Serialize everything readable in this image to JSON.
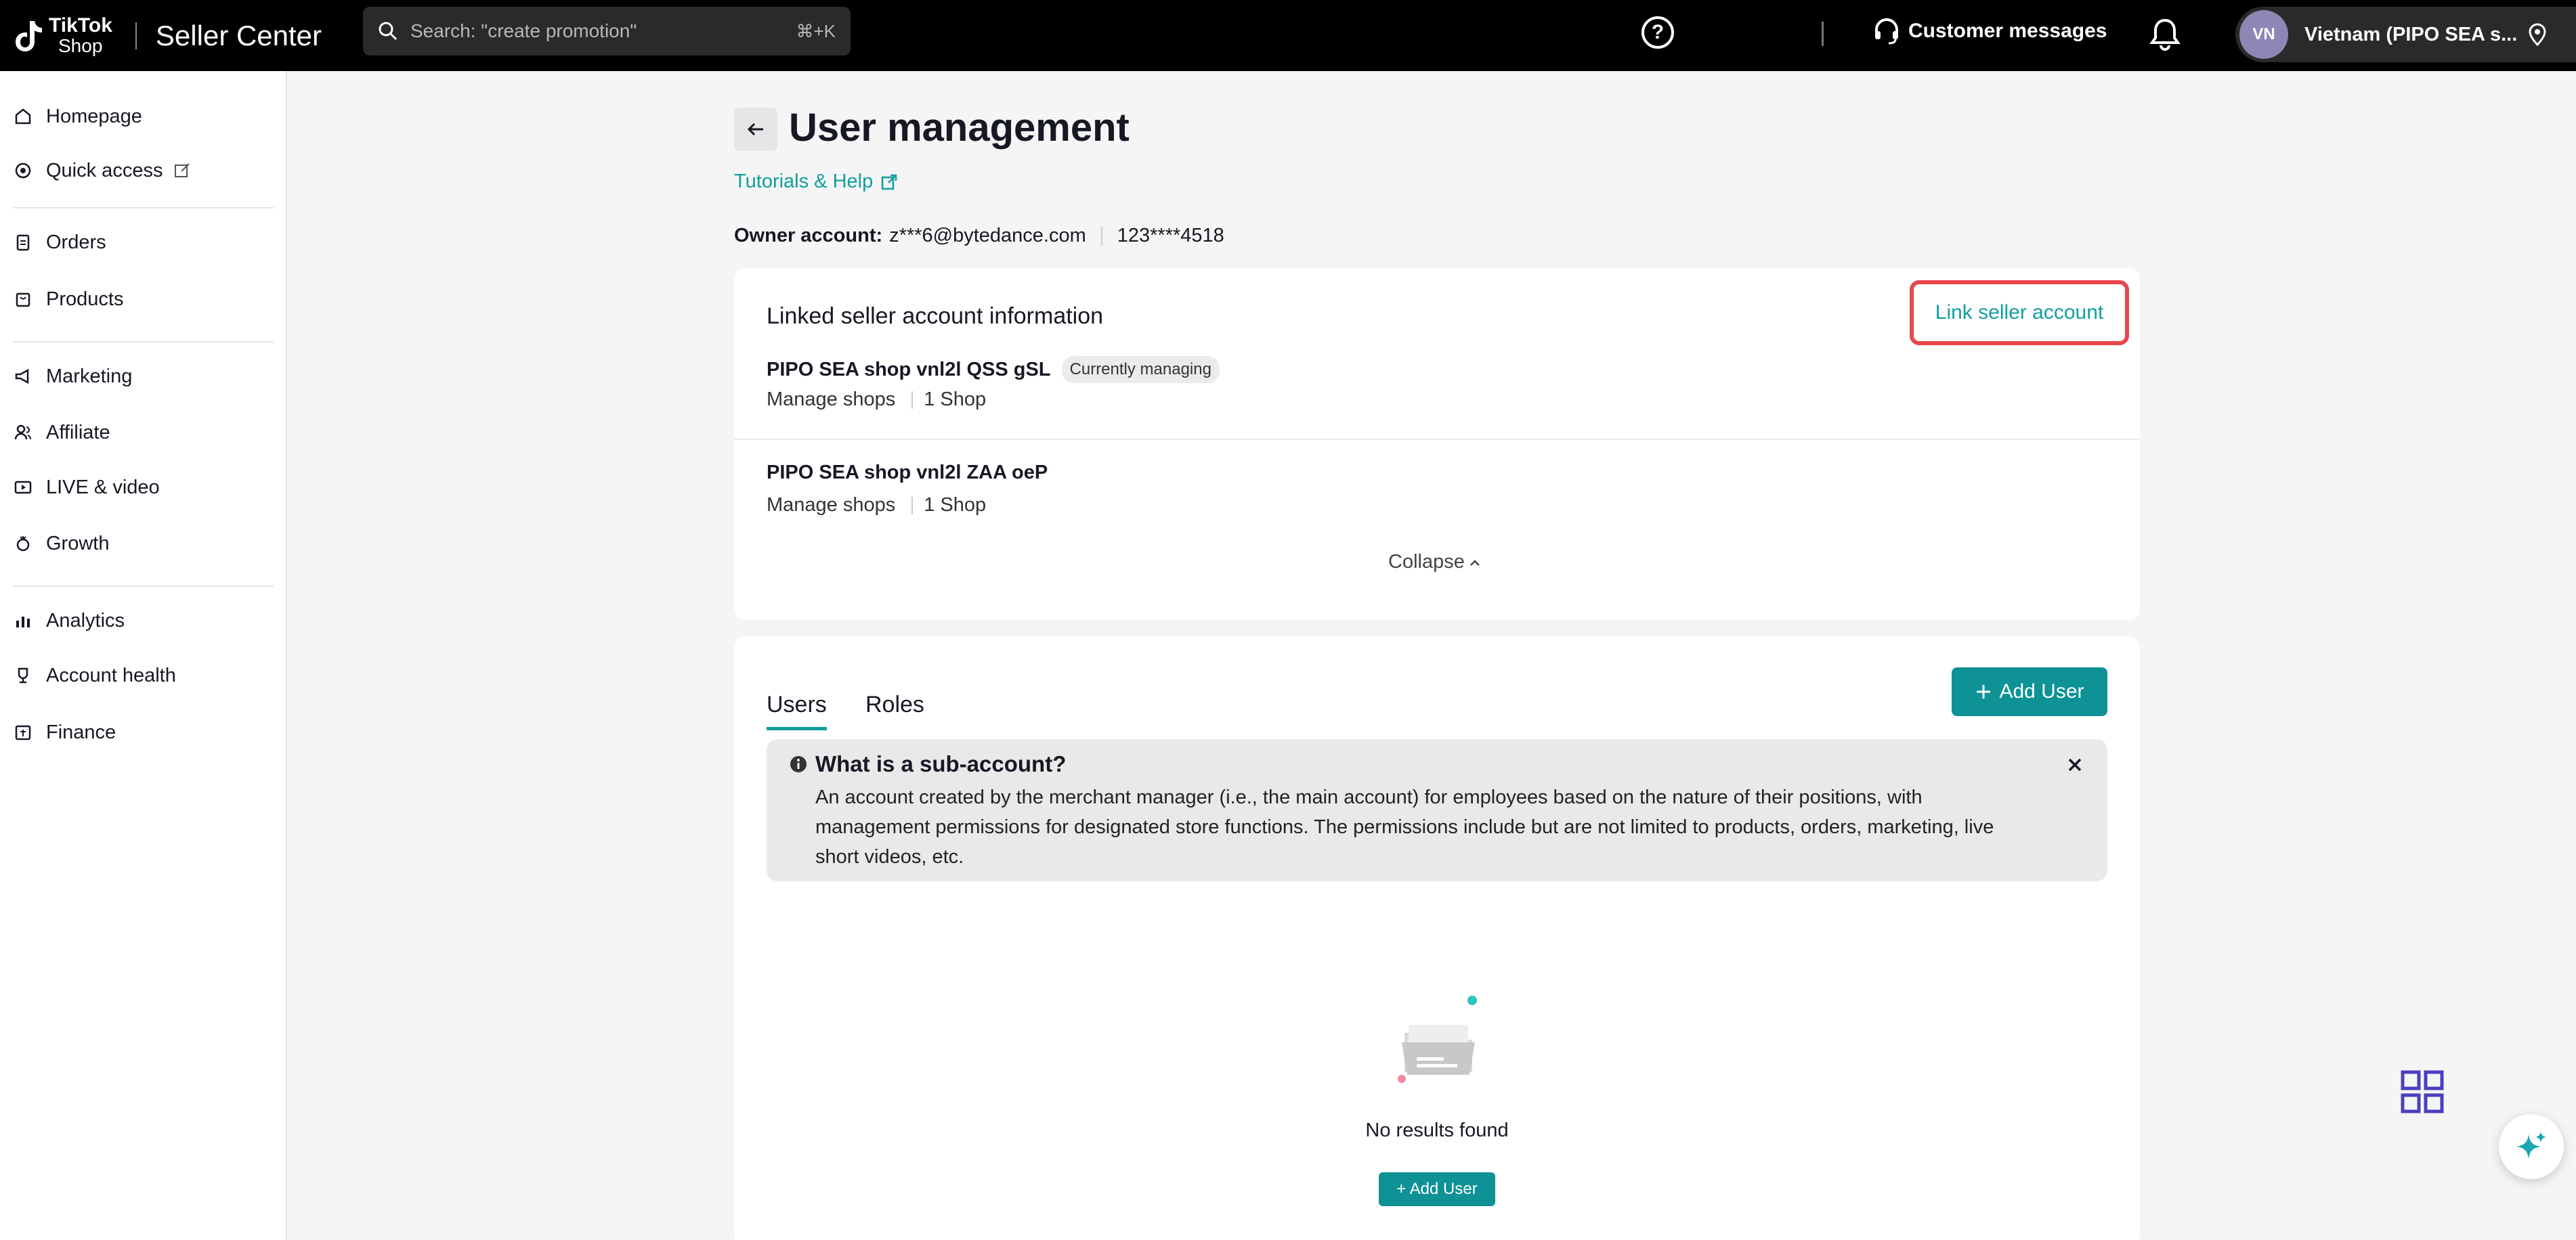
{
  "header": {
    "logo_top": "TikTok",
    "logo_bottom": "Shop",
    "brand": "Seller Center",
    "search_placeholder": "Search: \"create promotion\"",
    "search_shortcut": "⌘+K",
    "help_glyph": "?",
    "customer_messages": "Customer messages",
    "avatar_initials": "VN",
    "account_label": "Vietnam  (PIPO SEA s..."
  },
  "sidebar": {
    "items": [
      {
        "label": "Homepage",
        "icon": "home-icon"
      },
      {
        "label": "Quick access",
        "icon": "quick-access-icon"
      },
      {
        "label": "Orders",
        "icon": "orders-icon"
      },
      {
        "label": "Products",
        "icon": "products-icon"
      },
      {
        "label": "Marketing",
        "icon": "megaphone-icon"
      },
      {
        "label": "Affiliate",
        "icon": "affiliate-icon"
      },
      {
        "label": "LIVE & video",
        "icon": "video-icon"
      },
      {
        "label": "Growth",
        "icon": "growth-icon"
      },
      {
        "label": "Analytics",
        "icon": "analytics-icon"
      },
      {
        "label": "Account health",
        "icon": "trophy-icon"
      },
      {
        "label": "Finance",
        "icon": "finance-icon"
      }
    ]
  },
  "page": {
    "title": "User management",
    "tutorials": "Tutorials & Help",
    "owner_label": "Owner account:",
    "owner_email": "z***6@bytedance.com",
    "owner_phone": "123****4518"
  },
  "linked": {
    "title": "Linked seller account information",
    "link_button": "Link seller account",
    "shops": [
      {
        "name": "PIPO SEA shop vnl2l QSS gSL",
        "badge": "Currently managing",
        "manage": "Manage shops",
        "count": "1 Shop"
      },
      {
        "name": "PIPO SEA shop vnl2l ZAA oeP",
        "manage": "Manage shops",
        "count": "1 Shop"
      }
    ],
    "collapse": "Collapse"
  },
  "users": {
    "tabs": [
      "Users",
      "Roles"
    ],
    "active_tab": "Users",
    "add_user": "Add User",
    "info_title": "What is a sub-account?",
    "info_body": "An account created by the merchant manager (i.e., the main account) for employees based on the nature of their positions, with management permissions for designated store functions. The permissions include but are not limited to products, orders, marketing, live short videos, etc.",
    "empty_text": "No results found",
    "empty_add_user": "+ Add User"
  },
  "colors": {
    "accent": "#0e9296",
    "link": "#119ea0",
    "highlight": "#e8474c"
  }
}
